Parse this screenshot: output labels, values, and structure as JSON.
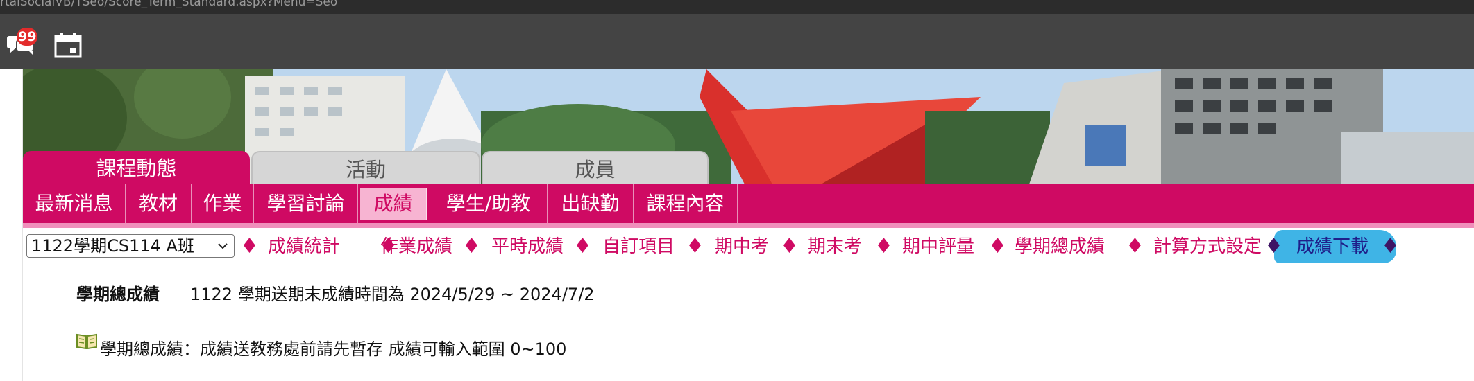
{
  "browser": {
    "url_fragment": "rtalSocialVB/TSeo/Score_Term_Standard.aspx?Menu=Seo"
  },
  "toolbar": {
    "message_badge": "99",
    "message_icon": "chat-bubbles-icon",
    "calendar_icon": "calendar-icon"
  },
  "tabs": {
    "course": "課程動態",
    "activity": "活動",
    "member": "成員"
  },
  "subnav": {
    "items": [
      "最新消息",
      "教材",
      "作業",
      "學習討論",
      "成績",
      "學生/助教",
      "出缺勤",
      "課程內容"
    ],
    "active": "成績"
  },
  "grade": {
    "semester_selected": "1122學期CS114 A班",
    "links": [
      "成績統計",
      "作業成績",
      "平時成績",
      "自訂項目",
      "期中考",
      "期末考",
      "期中評量",
      "學期總成績",
      "計算方式設定",
      "成績下載"
    ]
  },
  "info": {
    "label": "學期總成績",
    "text": "1122 學期送期末成績時間為 2024/5/29 ~ 2024/7/2",
    "note": "學期總成績：成績送教務處前請先暫存 成績可輸入範圍 0~100",
    "note_icon": "open-book-icon"
  },
  "colors": {
    "brand": "#cf0a63",
    "active_subnav_bg": "#f7b4d2",
    "download_highlight": "#3fb4e6",
    "toolbar_bg": "#444444"
  }
}
